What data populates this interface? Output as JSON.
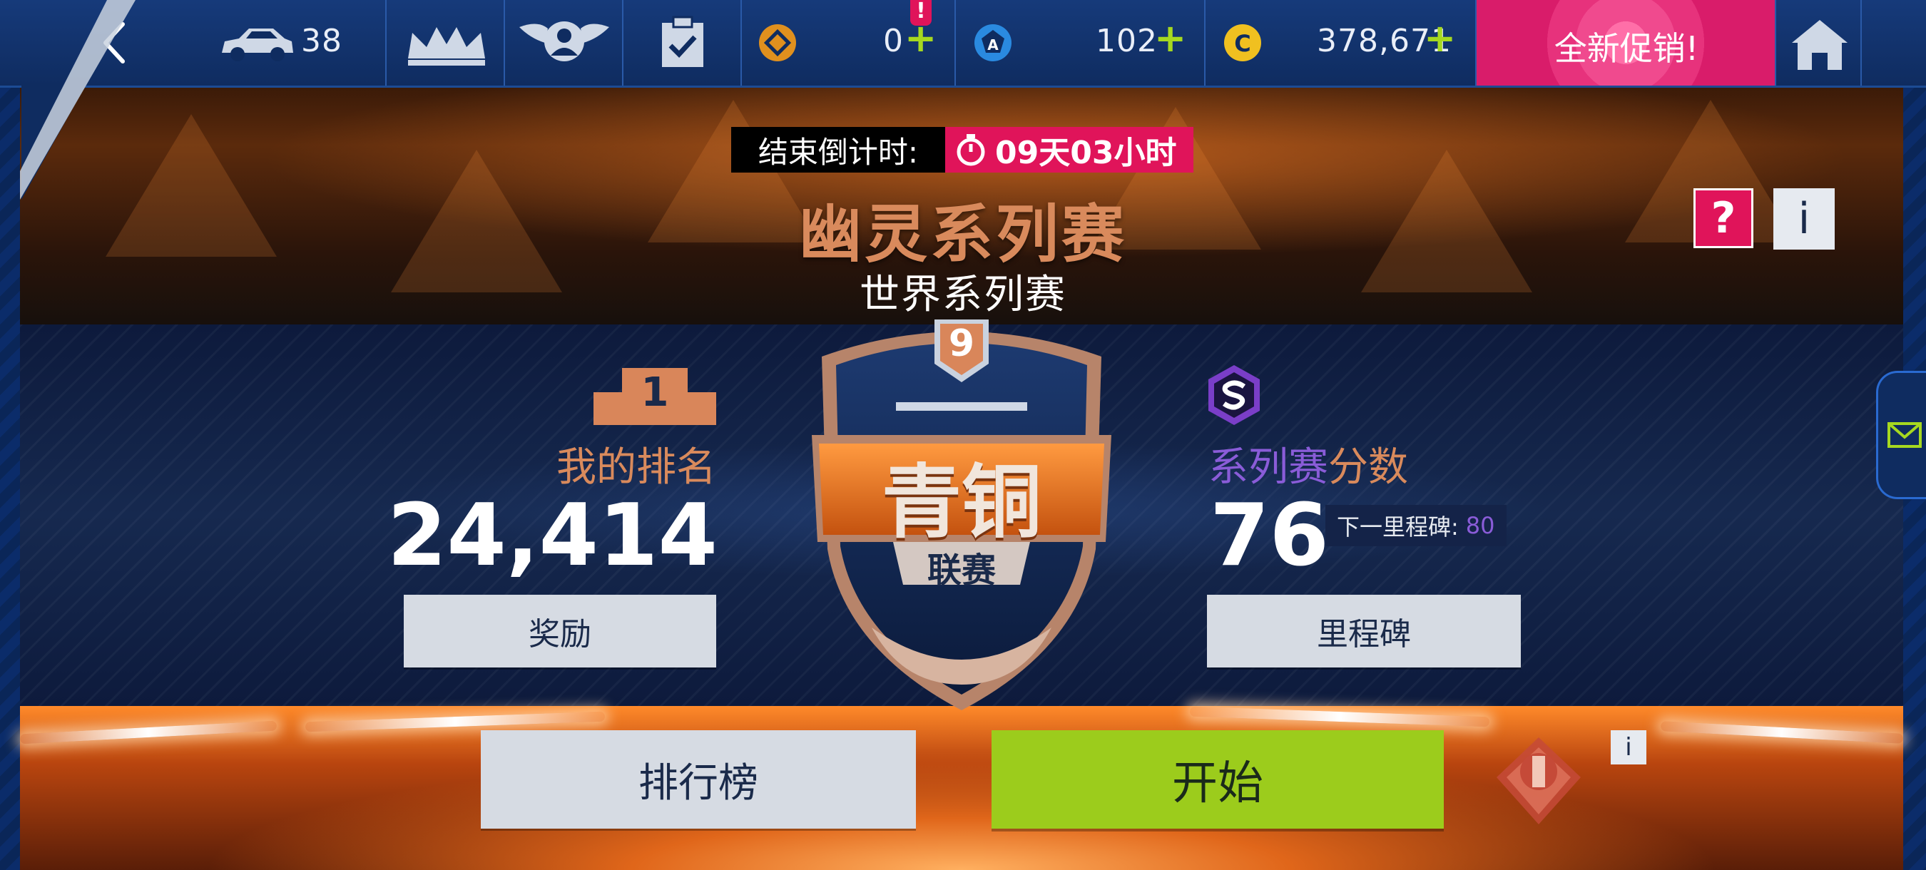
{
  "topbar": {
    "car_count": "38",
    "alert_badge": "!",
    "token_count": "0",
    "blueprint_count": "102",
    "credits": "378,671",
    "promo_label": "全新促销!"
  },
  "event": {
    "countdown_label": "结束倒计时:",
    "countdown_value": "09天03小时",
    "title": "幽灵系列赛",
    "subtitle": "世界系列赛",
    "help_label": "?",
    "info_label": "i"
  },
  "ranking": {
    "podium_number": "1",
    "label": "我的排名",
    "value": "24,414",
    "rewards_button": "奖励"
  },
  "league": {
    "tier_number": "9",
    "name": "青铜",
    "suffix": "联赛"
  },
  "series": {
    "label_part1": "系列赛",
    "label_part2": "分数",
    "score": "76",
    "next_milestone_label": "下一里程碑:",
    "next_milestone_value": "80",
    "milestones_button": "里程碑"
  },
  "actions": {
    "leaderboard_button": "排行榜",
    "start_button": "开始",
    "emblem_info": "i"
  },
  "colors": {
    "accent_pink": "#e0145a",
    "start_green": "#9ccc1c",
    "title_bronze": "#d98a5c",
    "series_purple": "#8a5cd8",
    "plus_green": "#a6d820"
  },
  "icons": [
    "back-icon",
    "car-icon",
    "crown-icon",
    "profile-emblem-icon",
    "clipboard-check-icon",
    "token-icon",
    "blueprint-icon",
    "credits-icon",
    "home-icon",
    "stopwatch-icon",
    "podium-icon",
    "series-s-icon",
    "mail-icon",
    "club-emblem-icon"
  ]
}
